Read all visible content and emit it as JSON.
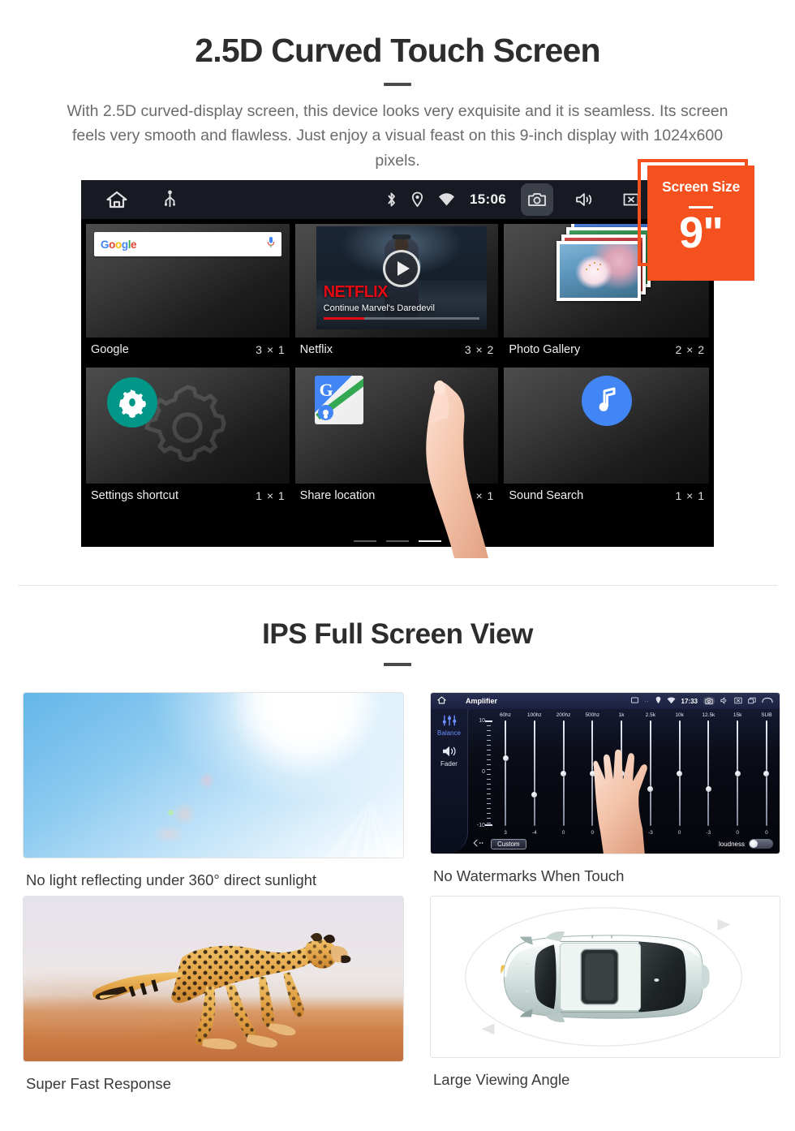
{
  "section_one": {
    "title": "2.5D Curved Touch Screen",
    "subtitle": "With 2.5D curved-display screen, this device looks very exquisite and it is seamless. Its screen feels very smooth and flawless. Just enjoy a visual feast on this 9-inch display with 1024x600 pixels.",
    "badge": {
      "label": "Screen Size",
      "value": "9\""
    },
    "device": {
      "status_bar": {
        "time": "15:06",
        "left_icons": [
          "home-icon",
          "usb-icon"
        ],
        "right_icons": [
          "bluetooth-icon",
          "location-icon",
          "wifi-icon",
          "camera-icon",
          "volume-icon",
          "close-icon",
          "recent-apps-icon"
        ]
      },
      "widgets": [
        {
          "name": "Google",
          "size": "3 × 1",
          "icon": "google-search-widget",
          "search_placeholder": "Google"
        },
        {
          "name": "Netflix",
          "size": "3 × 2",
          "icon": "netflix-widget",
          "brand": "NETFLIX",
          "caption": "Continue Marvel's Daredevil"
        },
        {
          "name": "Photo Gallery",
          "size": "2 × 2",
          "icon": "photo-gallery-widget"
        },
        {
          "name": "Settings shortcut",
          "size": "1 × 1",
          "icon": "gear-icon"
        },
        {
          "name": "Share location",
          "size": "1 × 1",
          "icon": "google-maps-icon"
        },
        {
          "name": "Sound Search",
          "size": "1 × 1",
          "icon": "music-note-icon"
        }
      ],
      "page_indicator": {
        "count": 3,
        "active": 3
      }
    }
  },
  "section_two": {
    "title": "IPS Full Screen View",
    "features": [
      {
        "caption": "No light reflecting under 360° direct sunlight",
        "image": "sunny-sky-photo"
      },
      {
        "caption": "No Watermarks When Touch",
        "image": "amplifier-equalizer-screenshot"
      },
      {
        "caption": "Super Fast Response",
        "image": "running-cheetah-photo"
      },
      {
        "caption": "Large Viewing Angle",
        "image": "top-down-car-diagram"
      }
    ],
    "amplifier": {
      "title": "Amplifier",
      "time": "17:33",
      "side_items": [
        {
          "label": "Balance",
          "icon": "equalizer-icon",
          "active": true
        },
        {
          "label": "Fader",
          "icon": "speaker-icon",
          "active": false
        }
      ],
      "scale": [
        "10",
        "0",
        "-10"
      ],
      "bands": [
        "60hz",
        "100hz",
        "200hz",
        "500hz",
        "1k",
        "2.5k",
        "10k",
        "12.5k",
        "15k",
        "SUB"
      ],
      "values": [
        "3",
        "-4",
        "0",
        "0",
        "0",
        "-3",
        "0",
        "-3",
        "0",
        "0"
      ],
      "preset": "Custom",
      "loudness_label": "loudness"
    }
  },
  "colors": {
    "accent": "#f4511e",
    "heading": "#2d2d2d",
    "body_text": "#6b6b6b",
    "netflix_red": "#e50914",
    "google_blue": "#4285f4",
    "settings_teal": "#009688"
  }
}
